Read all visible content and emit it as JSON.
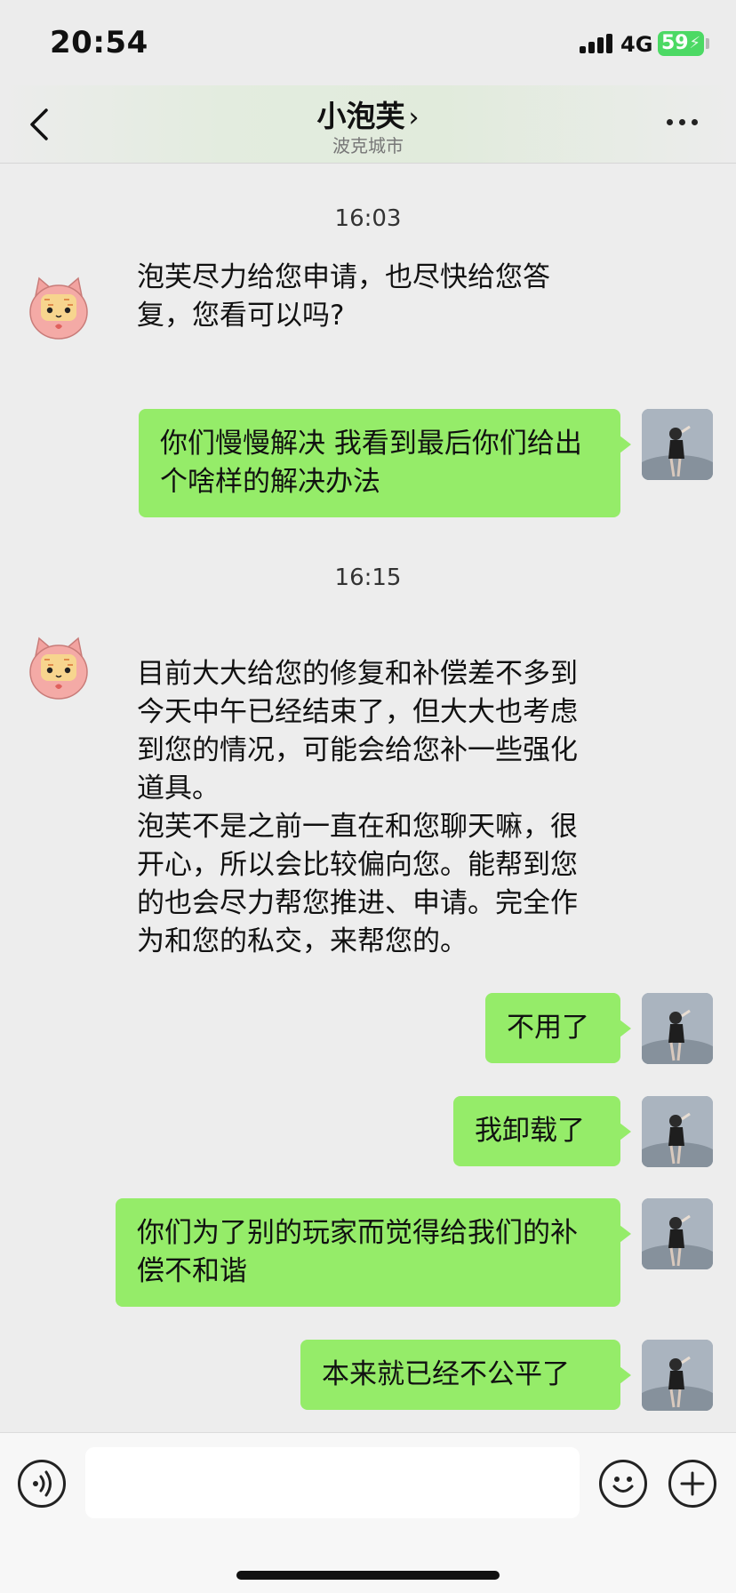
{
  "status_bar": {
    "time": "20:54",
    "network": "4G",
    "battery": "59"
  },
  "header": {
    "title": "小泡芙",
    "title_chevron": "›",
    "subtitle": "波克城市",
    "back_icon": "chevron-left-icon",
    "more_icon": "more-dots-icon"
  },
  "messages": [
    {
      "type": "time",
      "text": "16:03"
    },
    {
      "type": "in",
      "sender": "小泡芙",
      "text": "泡芙尽力给您申请，也尽快给您答复，您看可以吗?"
    },
    {
      "type": "out",
      "text": "你们慢慢解决 我看到最后你们给出个啥样的解决办法"
    },
    {
      "type": "time",
      "text": "16:15"
    },
    {
      "type": "in",
      "sender": "小泡芙",
      "text": "目前大大给您的修复和补偿差不多到今天中午已经结束了，但大大也考虑到您的情况，可能会给您补一些强化道具。\n泡芙不是之前一直在和您聊天嘛，很开心，所以会比较偏向您。能帮到您的也会尽力帮您推进、申请。完全作为和您的私交，来帮您的。"
    },
    {
      "type": "out",
      "text": "不用了"
    },
    {
      "type": "out",
      "text": "我卸载了"
    },
    {
      "type": "out",
      "text": "你们为了别的玩家而觉得给我们的补偿不和谐"
    },
    {
      "type": "out",
      "text": "本来就已经不公平了"
    }
  ],
  "input_bar": {
    "voice_icon": "voice-icon",
    "emoji_icon": "emoji-icon",
    "plus_icon": "plus-icon",
    "input_value": ""
  },
  "colors": {
    "outgoing_bubble": "#95ec69",
    "chat_background": "#ededed",
    "battery_green": "#4cd964"
  }
}
